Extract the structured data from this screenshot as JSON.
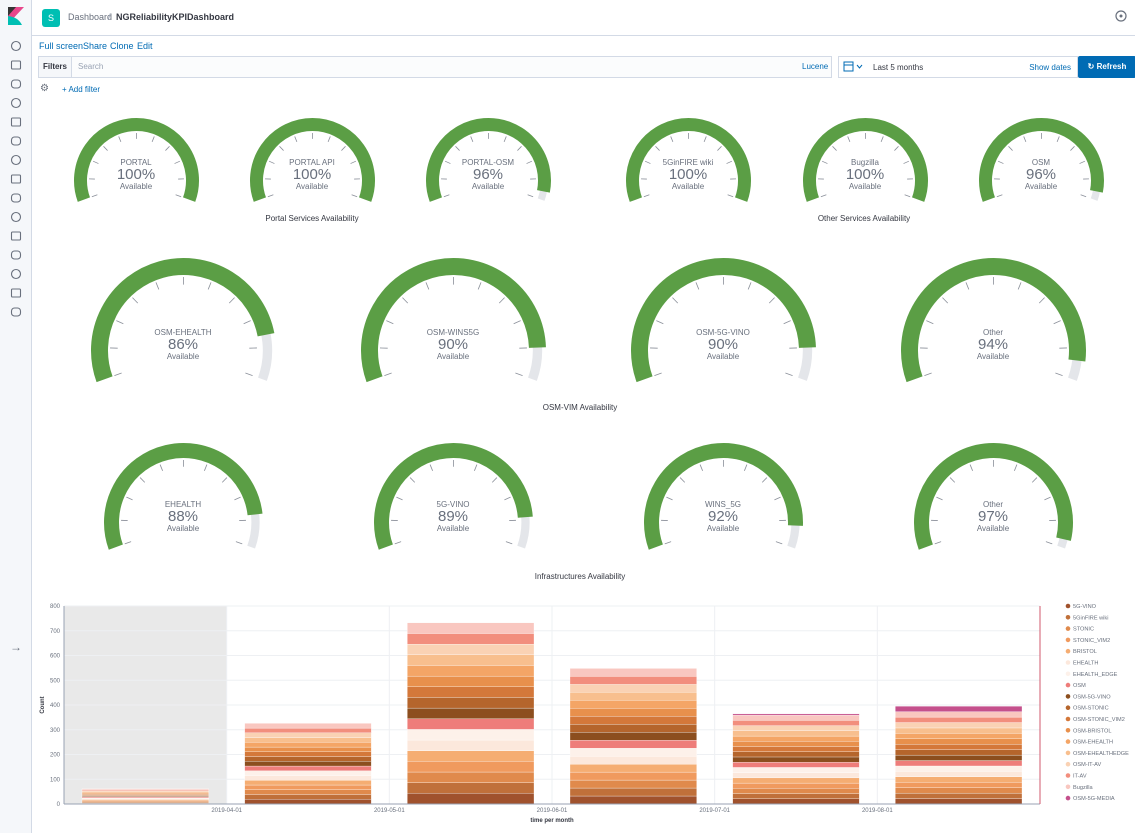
{
  "nav": {
    "icons": [
      "clock-icon",
      "compass-icon",
      "visualize-icon",
      "dashboard-icon",
      "canvas-icon",
      "maps-icon",
      "ml-icon",
      "infrastructure-icon",
      "logs-icon",
      "apm-icon",
      "uptime-icon",
      "siem-icon",
      "devtools-icon",
      "monitoring-icon",
      "management-icon"
    ],
    "collapse_icon": "→"
  },
  "header": {
    "space_letter": "S",
    "breadcrumbs": [
      "Dashboard",
      "NGReliabilityKPIDashboard"
    ],
    "breadcrumb_sep": "/"
  },
  "menu": [
    "Full screen",
    "Share",
    "Clone",
    "Edit"
  ],
  "query": {
    "filters_label": "Filters",
    "search_placeholder": "Search",
    "lucene": "Lucene",
    "date_text": "Last 5 months",
    "show_dates": "Show dates",
    "refresh": "Refresh",
    "add_filter": "+ Add filter"
  },
  "sections": {
    "portal": "Portal Services Availability",
    "other": "Other Services Availability",
    "osmvim": "OSM-VIM Availability",
    "infra": "Infrastructures Availability"
  },
  "gauges_row1": [
    {
      "title": "PORTAL",
      "value": "100%",
      "sub": "Available",
      "fraction": 1.0
    },
    {
      "title": "PORTAL API",
      "value": "100%",
      "sub": "Available",
      "fraction": 1.0
    },
    {
      "title": "PORTAL-OSM",
      "value": "96%",
      "sub": "Available",
      "fraction": 0.96
    },
    {
      "title": "5GinFIRE wiki",
      "value": "100%",
      "sub": "Available",
      "fraction": 1.0
    },
    {
      "title": "Bugzilla",
      "value": "100%",
      "sub": "Available",
      "fraction": 1.0
    },
    {
      "title": "OSM",
      "value": "96%",
      "sub": "Available",
      "fraction": 0.96
    }
  ],
  "gauges_row2": [
    {
      "title": "OSM-EHEALTH",
      "value": "86%",
      "sub": "Available",
      "fraction": 0.86
    },
    {
      "title": "OSM-WINS5G",
      "value": "90%",
      "sub": "Available",
      "fraction": 0.9
    },
    {
      "title": "OSM-5G-VINO",
      "value": "90%",
      "sub": "Available",
      "fraction": 0.9
    },
    {
      "title": "Other",
      "value": "94%",
      "sub": "Available",
      "fraction": 0.94
    }
  ],
  "gauges_row3": [
    {
      "title": "EHEALTH",
      "value": "88%",
      "sub": "Available",
      "fraction": 0.88
    },
    {
      "title": "5G-VINO",
      "value": "89%",
      "sub": "Available",
      "fraction": 0.89
    },
    {
      "title": "WINS_5G",
      "value": "92%",
      "sub": "Available",
      "fraction": 0.92
    },
    {
      "title": "Other",
      "value": "97%",
      "sub": "Available",
      "fraction": 0.97
    }
  ],
  "colors": {
    "gauge_green": "#5b9e45",
    "gauge_track": "#e4e6ea",
    "accent": "#006bb4"
  },
  "chart_data": {
    "type": "bar",
    "stacked": true,
    "xlabel": "time per month",
    "ylabel": "Count",
    "ylim": [
      0,
      800
    ],
    "yticks": [
      "0",
      "100",
      "200",
      "300",
      "400",
      "500",
      "600",
      "700",
      "800"
    ],
    "x_tick_labels": [
      "2019-04-01",
      "2019-05-01",
      "2019-06-01",
      "2019-07-01",
      "2019-08-01"
    ],
    "categories": [
      "2019-03",
      "2019-04",
      "2019-05",
      "2019-06",
      "2019-07",
      "2019-08"
    ],
    "shaded_region": "before 2019-04-01",
    "totals": [
      65,
      345,
      775,
      580,
      380,
      395
    ],
    "series": [
      {
        "name": "5G-VINO",
        "color": "#a0522d"
      },
      {
        "name": "5GinFIRE wiki",
        "color": "#c0703a"
      },
      {
        "name": "STONIC",
        "color": "#e08a4c"
      },
      {
        "name": "STONIC_VIM2",
        "color": "#f09a5e"
      },
      {
        "name": "BRISTOL",
        "color": "#f5ad72"
      },
      {
        "name": "EHEALTH",
        "color": "#fce8dc"
      },
      {
        "name": "EHEALTH_EDGE",
        "color": "#fdf1ea"
      },
      {
        "name": "OSM",
        "color": "#ee7d7a"
      },
      {
        "name": "OSM-5G-VINO",
        "color": "#8c4e1e"
      },
      {
        "name": "OSM-STONIC",
        "color": "#b5652c"
      },
      {
        "name": "OSM-STONIC_VIM2",
        "color": "#d4783a"
      },
      {
        "name": "OSM-BRISTOL",
        "color": "#e8904c"
      },
      {
        "name": "OSM-EHEALTH",
        "color": "#f4a566"
      },
      {
        "name": "OSM-EHEALTHEDGE",
        "color": "#f8bf8e"
      },
      {
        "name": "OSM-IT-AV",
        "color": "#fad2b4"
      },
      {
        "name": "IT-AV",
        "color": "#f28e7d"
      },
      {
        "name": "Bugzilla",
        "color": "#f9c7c0"
      },
      {
        "name": "OSM-5G-MEDIA",
        "color": "#c4508c"
      }
    ],
    "grid": true,
    "legend": "right"
  }
}
